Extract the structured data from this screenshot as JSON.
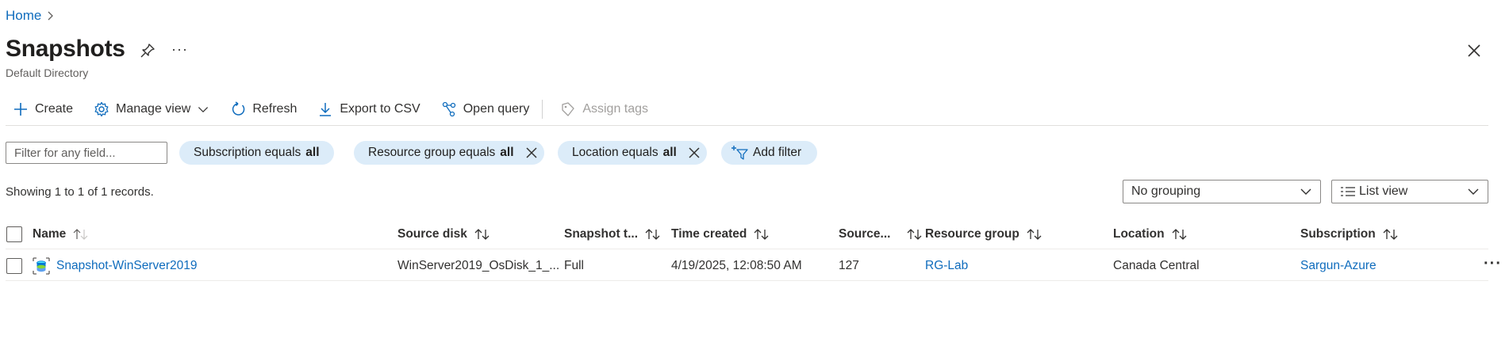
{
  "breadcrumb": {
    "home": "Home",
    "chevron": "chevron-right-icon"
  },
  "header": {
    "title": "Snapshots",
    "subtitle": "Default Directory",
    "more": "···"
  },
  "toolbar": {
    "create": "Create",
    "manage_view": "Manage view",
    "refresh": "Refresh",
    "export_csv": "Export to CSV",
    "open_query": "Open query",
    "assign_tags": "Assign tags"
  },
  "filters": {
    "placeholder": "Filter for any field...",
    "subscription": {
      "label": "Subscription equals",
      "value": "all"
    },
    "resource_group": {
      "label": "Resource group equals",
      "value": "all"
    },
    "location": {
      "label": "Location equals",
      "value": "all"
    },
    "add_filter": "Add filter"
  },
  "records_text": "Showing 1 to 1 of 1 records.",
  "grouping": {
    "selected": "No grouping"
  },
  "view": {
    "selected": "List view"
  },
  "table": {
    "columns": {
      "name": "Name",
      "source_disk": "Source disk",
      "snapshot_type": "Snapshot t...",
      "time_created": "Time created",
      "source_size": "Source...",
      "resource_group": "Resource group",
      "location": "Location",
      "subscription": "Subscription"
    },
    "rows": [
      {
        "name": "Snapshot-WinServer2019",
        "source_disk": "WinServer2019_OsDisk_1_...",
        "snapshot_type": "Full",
        "time_created": "4/19/2025, 12:08:50 AM",
        "source_size": "127",
        "resource_group": "RG-Lab",
        "location": "Canada Central",
        "subscription": "Sargun-Azure",
        "more": "···"
      }
    ]
  },
  "colors": {
    "accent": "#0f6cbd",
    "pill_bg": "#dcecf9",
    "text": "#323130"
  }
}
